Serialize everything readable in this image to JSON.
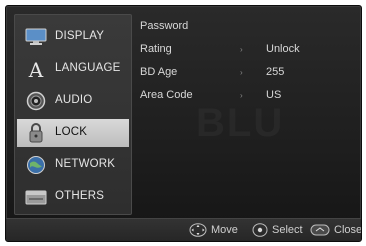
{
  "menu": {
    "items": [
      {
        "label": "DISPLAY",
        "icon": "display-icon"
      },
      {
        "label": "LANGUAGE",
        "icon": "language-icon"
      },
      {
        "label": "AUDIO",
        "icon": "audio-icon"
      },
      {
        "label": "LOCK",
        "icon": "lock-icon",
        "selected": true
      },
      {
        "label": "NETWORK",
        "icon": "network-icon"
      },
      {
        "label": "OTHERS",
        "icon": "others-icon"
      }
    ]
  },
  "lock_settings": {
    "password_label": "Password",
    "rating_label": "Rating",
    "rating_value": "Unlock",
    "bd_age_label": "BD Age",
    "bd_age_value": "255",
    "area_code_label": "Area Code",
    "area_code_value": "US",
    "arrow": "›"
  },
  "footer": {
    "move_label": "Move",
    "select_label": "Select",
    "close_label": "Close"
  },
  "colors": {
    "panel": "#1e1e1e",
    "sidebar": "#333333",
    "selected": "#cccccc",
    "text": "#e6e6e6"
  }
}
